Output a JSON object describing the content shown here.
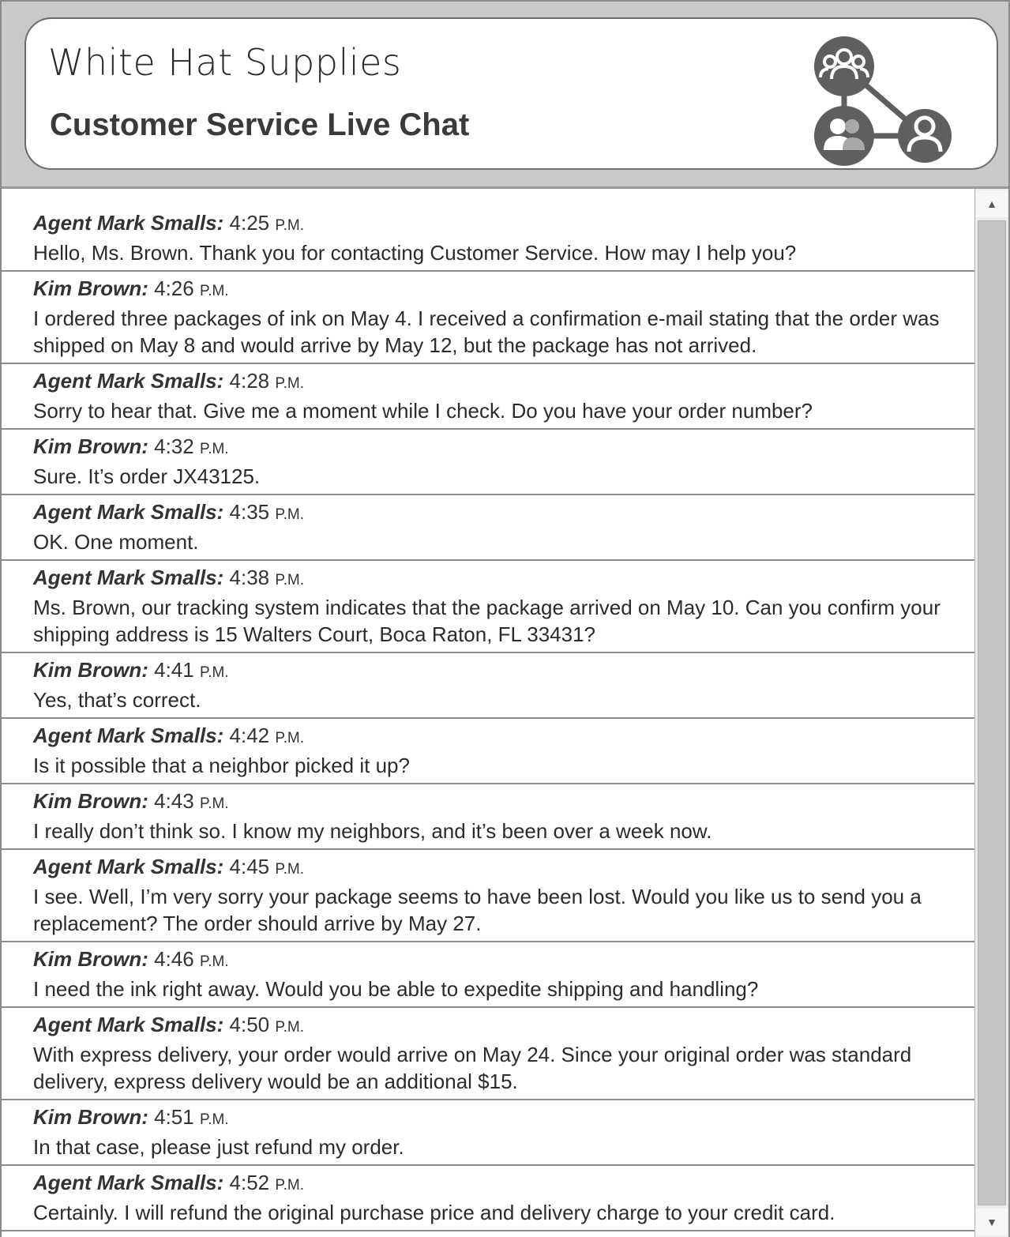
{
  "header": {
    "brand_title": "White Hat Supplies",
    "subtitle": "Customer Service Live Chat",
    "icon": "people-network-icon"
  },
  "colors": {
    "header_band": "#c9c9c9",
    "icon_gray": "#5f5f5f",
    "divider": "#8e8e8e"
  },
  "chat": {
    "messages": [
      {
        "speaker": "Agent Mark Smalls:",
        "time": "4:25",
        "ampm": "P.M.",
        "text": "Hello, Ms. Brown. Thank you for contacting Customer Service. How may I help you?"
      },
      {
        "speaker": "Kim Brown:",
        "time": "4:26",
        "ampm": "P.M.",
        "text": "I ordered three packages of ink on May 4. I received a confirmation e-mail stating that the order was shipped on May 8 and would arrive by May 12, but the package has not arrived."
      },
      {
        "speaker": "Agent Mark Smalls:",
        "time": "4:28",
        "ampm": "P.M.",
        "text": "Sorry to hear that. Give me a moment while I check. Do you have your order number?"
      },
      {
        "speaker": "Kim Brown:",
        "time": "4:32",
        "ampm": "P.M.",
        "text": "Sure. It’s order JX43125."
      },
      {
        "speaker": "Agent Mark Smalls:",
        "time": "4:35",
        "ampm": "P.M.",
        "text": "OK. One moment."
      },
      {
        "speaker": "Agent Mark Smalls:",
        "time": "4:38",
        "ampm": "P.M.",
        "text": "Ms. Brown, our tracking system indicates that the package arrived on May 10. Can you confirm your shipping address is 15 Walters Court, Boca Raton, FL 33431?"
      },
      {
        "speaker": "Kim Brown:",
        "time": "4:41",
        "ampm": "P.M.",
        "text": "Yes, that’s correct."
      },
      {
        "speaker": "Agent Mark Smalls:",
        "time": "4:42",
        "ampm": "P.M.",
        "text": "Is it possible that a neighbor picked it up?"
      },
      {
        "speaker": "Kim Brown:",
        "time": "4:43",
        "ampm": "P.M.",
        "text": "I really don’t think so. I know my neighbors, and it’s been over a week now."
      },
      {
        "speaker": "Agent Mark Smalls:",
        "time": "4:45",
        "ampm": "P.M.",
        "text": "I see. Well, I’m very sorry your package seems to have been lost. Would you like us to send you a replacement? The order should arrive by May 27."
      },
      {
        "speaker": "Kim Brown:",
        "time": "4:46",
        "ampm": "P.M.",
        "text": "I need the ink right away. Would you be able to expedite shipping and handling?"
      },
      {
        "speaker": "Agent Mark Smalls:",
        "time": "4:50",
        "ampm": "P.M.",
        "text": "With express delivery, your order would arrive on May 24. Since your original order was standard delivery, express delivery would be an additional $15."
      },
      {
        "speaker": "Kim Brown:",
        "time": "4:51",
        "ampm": "P.M.",
        "text": "In that case, please just refund my order."
      },
      {
        "speaker": "Agent Mark Smalls:",
        "time": "4:52",
        "ampm": "P.M.",
        "text": "Certainly. I will refund the original purchase price and delivery charge to your credit card."
      }
    ]
  },
  "scrollbar": {
    "up_icon": "scroll-up-arrow-icon",
    "down_icon": "scroll-down-arrow-icon"
  }
}
